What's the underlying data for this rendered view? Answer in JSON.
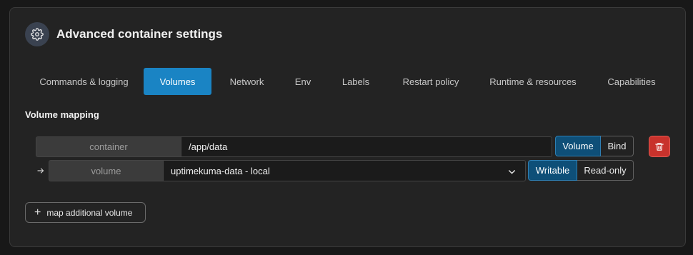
{
  "header": {
    "title": "Advanced container settings",
    "icon": "gear-icon"
  },
  "tabs": [
    {
      "label": "Commands & logging",
      "active": false
    },
    {
      "label": "Volumes",
      "active": true
    },
    {
      "label": "Network",
      "active": false
    },
    {
      "label": "Env",
      "active": false
    },
    {
      "label": "Labels",
      "active": false
    },
    {
      "label": "Restart policy",
      "active": false
    },
    {
      "label": "Runtime & resources",
      "active": false
    },
    {
      "label": "Capabilities",
      "active": false
    }
  ],
  "section": {
    "title": "Volume mapping"
  },
  "mapping": {
    "container_addon": "container",
    "container_path": "/app/data",
    "type_options": {
      "volume": "Volume",
      "bind": "Bind",
      "selected": "Volume"
    },
    "volume_addon": "volume",
    "volume_value": "uptimekuma-data - local",
    "mode_options": {
      "writable": "Writable",
      "readonly": "Read-only",
      "selected": "Writable"
    }
  },
  "actions": {
    "add_label": "map additional volume"
  },
  "colors": {
    "accent": "#1a84c4",
    "danger": "#c8322c",
    "selected_toggle": "#0e4f78"
  }
}
